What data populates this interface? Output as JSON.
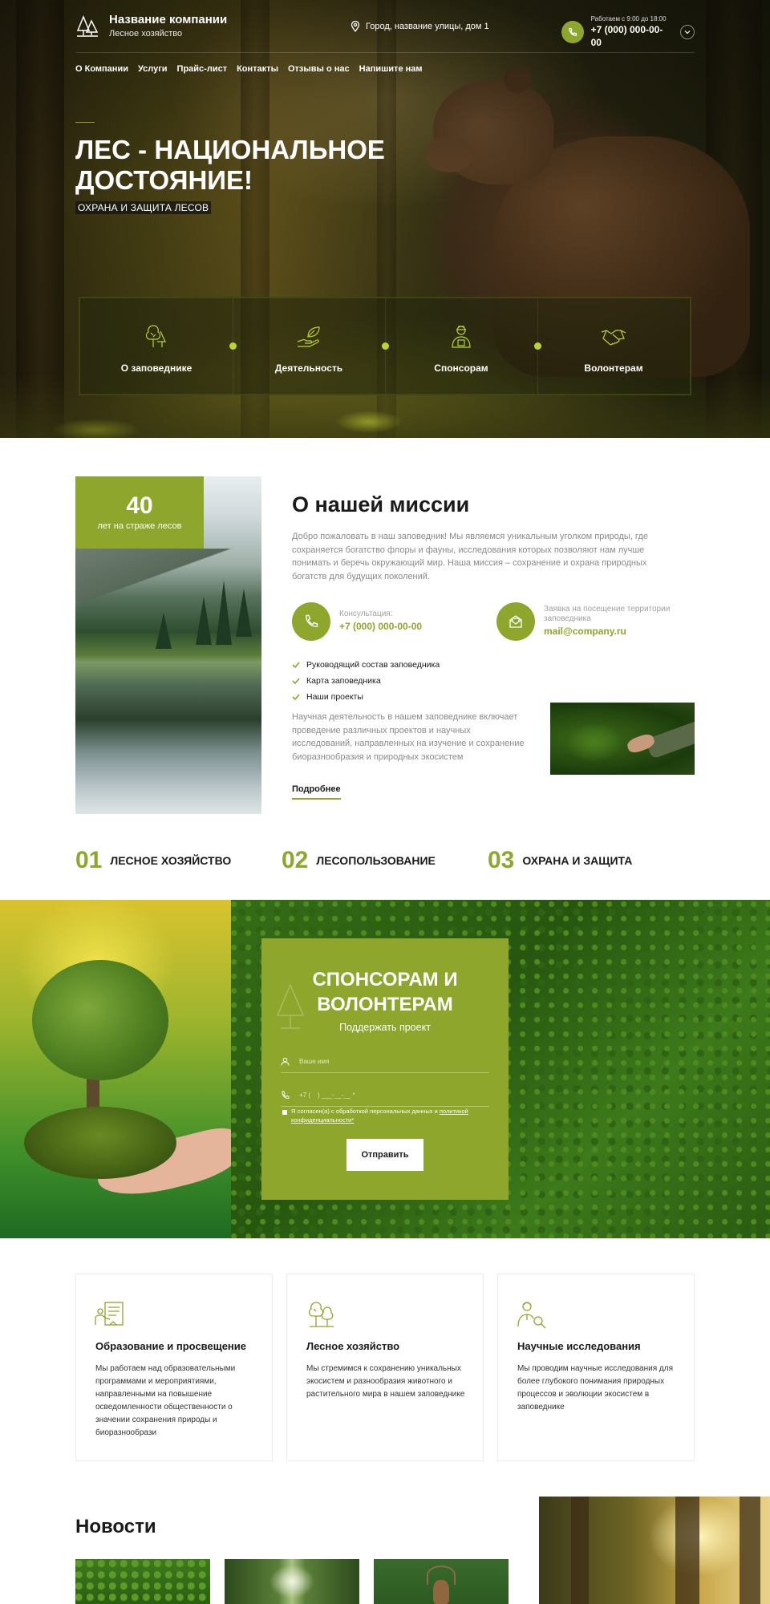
{
  "header": {
    "company_name": "Название компании",
    "company_sub": "Лесное хозяйство",
    "address": "Город, название улицы, дом 1",
    "work_hours": "Работаем с 9:00 до 18:00",
    "phone": "+7 (000) 000-00-00"
  },
  "nav": [
    "О Компании",
    "Услуги",
    "Прайс-лист",
    "Контакты",
    "Отзывы о нас",
    "Напишите нам"
  ],
  "hero": {
    "title": "ЛЕС - НАЦИОНАЛЬНОЕ ДОСТОЯНИЕ!",
    "tagline": "ОХРАНА И ЗАЩИТА ЛЕСОВ",
    "panel": [
      {
        "label": "О заповеднике",
        "icon": "tree-icon"
      },
      {
        "label": "Деятельность",
        "icon": "hand-leaf-icon"
      },
      {
        "label": "Спонсорам",
        "icon": "worker-icon"
      },
      {
        "label": "Волонтерам",
        "icon": "handshake-icon"
      }
    ]
  },
  "mission": {
    "badge_number": "40",
    "badge_text": "лет на страже лесов",
    "title": "О нашей миссии",
    "intro": "Добро пожаловать в наш заповедник! Мы являемся уникальным уголком природы, где сохраняется богатство флоры и фауны, исследования которых позволяют нам лучше понимать и беречь окружающий мир. Наша миссия – сохранение и охрана природных богатств для будущих поколений.",
    "consult_label": "Консультация:",
    "consult_value": "+7 (000) 000-00-00",
    "request_label": "Заявка на посещение территории заповедника",
    "request_value": "mail@company.ru",
    "checklist": [
      "Руководящий состав заповедника",
      "Карта заповедника",
      "Наши проекты"
    ],
    "science_text": "Научная деятельность в нашем заповеднике включает проведение различных проектов и научных исследований, направленных на изучение и сохранение биоразнообразия и природных экосистем",
    "more_link": "Подробнее"
  },
  "stats": [
    {
      "num": "01",
      "label": "ЛЕСНОЕ ХОЗЯЙСТВО"
    },
    {
      "num": "02",
      "label": "ЛЕСОПОЛЬЗОВАНИЕ"
    },
    {
      "num": "03",
      "label": "ОХРАНА И ЗАЩИТА"
    }
  ],
  "form": {
    "title": "СПОНСОРАМ И ВОЛОНТЕРАМ",
    "subtitle": "Поддержать проект",
    "name_placeholder": "Ваше имя",
    "phone_placeholder": "+7 (    ) ___-__-__ *",
    "agree_text": "Я согласен(а) с обработкой персональных данных и ",
    "agree_link": "политикой конфиденциальности*",
    "submit": "Отправить"
  },
  "services": [
    {
      "title": "Образование и просвещение",
      "text": "Мы работаем над образовательными программами и мероприятиями, направленными на повышение осведомленности общественности о значении сохранения природы и биоразнообрази",
      "icon": "education-icon"
    },
    {
      "title": "Лесное хозяйство",
      "text": "Мы стремимся к сохранению уникальных экосистем и разнообразия животного и растительного мира в нашем заповеднике",
      "icon": "trees-icon"
    },
    {
      "title": "Научные исследования",
      "text": "Мы проводим научные исследования для более глубокого понимания природных процессов и эволюции экосистем в заповеднике",
      "icon": "researcher-icon"
    }
  ],
  "news": {
    "title": "Новости"
  },
  "colors": {
    "accent": "#8ea62b",
    "text": "#1a1a1a",
    "muted": "#8a8a8a"
  }
}
